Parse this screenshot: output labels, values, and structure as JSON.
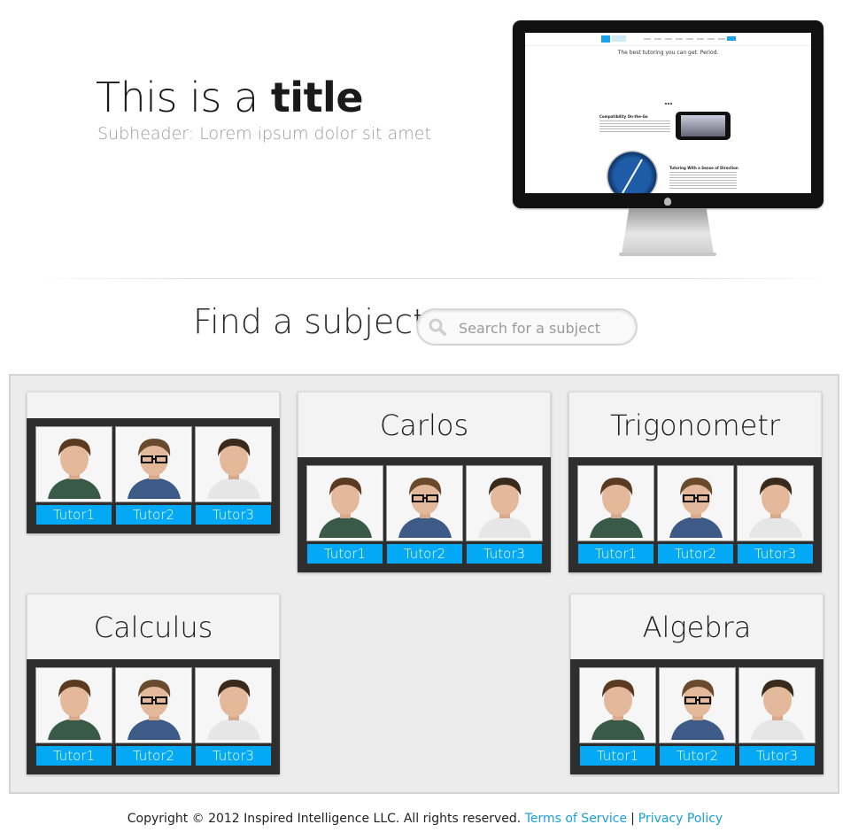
{
  "hero": {
    "title_prefix": "This is a",
    "title_bold": "title",
    "subheader": "Subheader: Lorem ipsum dolor sit amet"
  },
  "screen_preview": {
    "tagline": "The best tutoring you can get. Period.",
    "section1_heading": "Compatibility On-the-Go",
    "section2_heading": "Tutoring With a Sense of Direction"
  },
  "search": {
    "label": "Find a subject",
    "placeholder": "Search for a subject"
  },
  "cards": [
    {
      "title": "",
      "tutors": [
        "Tutor1",
        "Tutor2",
        "Tutor3"
      ]
    },
    {
      "title": "Carlos",
      "tutors": [
        "Tutor1",
        "Tutor2",
        "Tutor3"
      ]
    },
    {
      "title": "Trigonometr",
      "tutors": [
        "Tutor1",
        "Tutor2",
        "Tutor3"
      ]
    },
    {
      "title": "Calculus",
      "tutors": [
        "Tutor1",
        "Tutor2",
        "Tutor3"
      ]
    },
    {
      "title": "Algebra",
      "tutors": [
        "Tutor1",
        "Tutor2",
        "Tutor3"
      ]
    }
  ],
  "footer": {
    "copyright": "Copyright © 2012 Inspired Intelligence LLC. All rights reserved.",
    "terms": "Terms of Service",
    "separator": "|",
    "privacy": "Privacy Policy"
  },
  "colors": {
    "accent": "#03a9f4",
    "card_body": "#2e2e2e",
    "card_head": "#f3f3f3",
    "panel": "#ececec"
  },
  "icons": {
    "search": "search-icon",
    "tutor_photo": "person-photo-icon"
  }
}
